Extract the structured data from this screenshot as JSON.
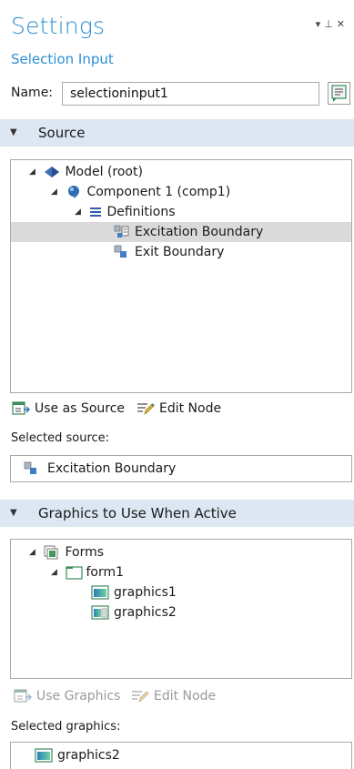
{
  "header": {
    "title": "Settings",
    "subtitle": "Selection Input",
    "controls": [
      "▾",
      "⊥",
      "✕"
    ]
  },
  "name_field": {
    "label": "Name:",
    "value": "selectioninput1"
  },
  "source_section": {
    "title": "Source",
    "tree": {
      "model": "Model (root)",
      "component": "Component 1 (comp1)",
      "definitions": "Definitions",
      "items": [
        "Excitation Boundary",
        "Exit Boundary"
      ],
      "selected_index": 0
    },
    "actions": {
      "use_as_source": "Use as Source",
      "edit_node": "Edit Node"
    },
    "selected_label": "Selected source:",
    "selected_value": "Excitation Boundary"
  },
  "graphics_section": {
    "title": "Graphics to Use When Active",
    "tree": {
      "forms": "Forms",
      "form": "form1",
      "items": [
        "graphics1",
        "graphics2"
      ]
    },
    "actions": {
      "use_graphics": "Use Graphics",
      "edit_node": "Edit Node"
    },
    "selected_label": "Selected graphics:",
    "selected_value": "graphics2"
  },
  "colors": {
    "accent": "#2c8fd4",
    "section_bg": "#dce7f3",
    "selection_bg": "#dadada"
  }
}
